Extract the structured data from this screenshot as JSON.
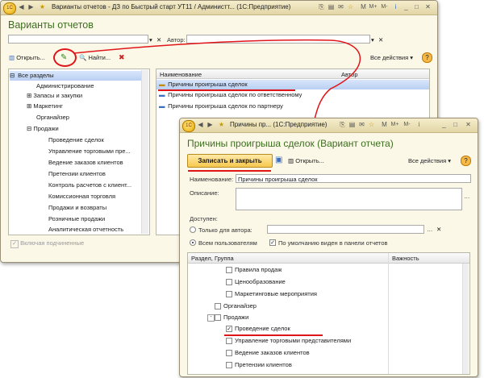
{
  "back_window": {
    "title": "Варианты отчетов - ДЗ по Быстрый старт УТ11 / Администт... (1С:Предприятие)",
    "caption": "Варианты отчетов",
    "author_label": "Автор:",
    "toolbar": {
      "open": "Открыть...",
      "find": "Найти...",
      "all_actions": "Все действия ▾"
    },
    "tree": {
      "root": "Все разделы",
      "items": [
        "Администрирование",
        "Запасы и закупки",
        "Маркетинг",
        "Органайзер",
        "Продажи"
      ],
      "sub_items": [
        "Проведение сделок",
        "Управление торговыми пре...",
        "Ведение заказов клиентов",
        "Претензии клиентов",
        "Контроль расчетов с клиент...",
        "Комиссионная торговля",
        "Продажи и возвраты",
        "Розничные продажи",
        "Аналитическая отчетность"
      ]
    },
    "grid": {
      "col_name": "Наименование",
      "col_author": "Автор",
      "rows": [
        "Причины проигрыша сделок",
        "Причины проигрыша сделок по ответственному",
        "Причины проигрыша сделок по партнеру"
      ]
    },
    "include_sub": "Включая подчиненные"
  },
  "front_window": {
    "title": "Причины пр...  (1С:Предприятие)",
    "caption": "Причины проигрыша сделок (Вариант отчета)",
    "save_close": "Записать и закрыть",
    "open": "Открыть...",
    "all_actions": "Все действия ▾",
    "name_label": "Наименование:",
    "name_value": "Причины проигрыша сделок",
    "desc_label": "Описание:",
    "access_label": "Доступен:",
    "only_author": "Только для автора:",
    "all_users": "Всем пользователям",
    "default_visible": "По умолчанию виден в панели отчетов",
    "grid": {
      "col_section": "Раздел, Группа",
      "col_importance": "Важность",
      "rows": [
        "Правила продаж",
        "Ценообразование",
        "Маркетинговые мероприятия",
        "Органайзер",
        "Продажи",
        "Проведение сделок",
        "Управление торговыми представителями",
        "Ведение заказов клиентов",
        "Претензии клиентов"
      ]
    }
  }
}
